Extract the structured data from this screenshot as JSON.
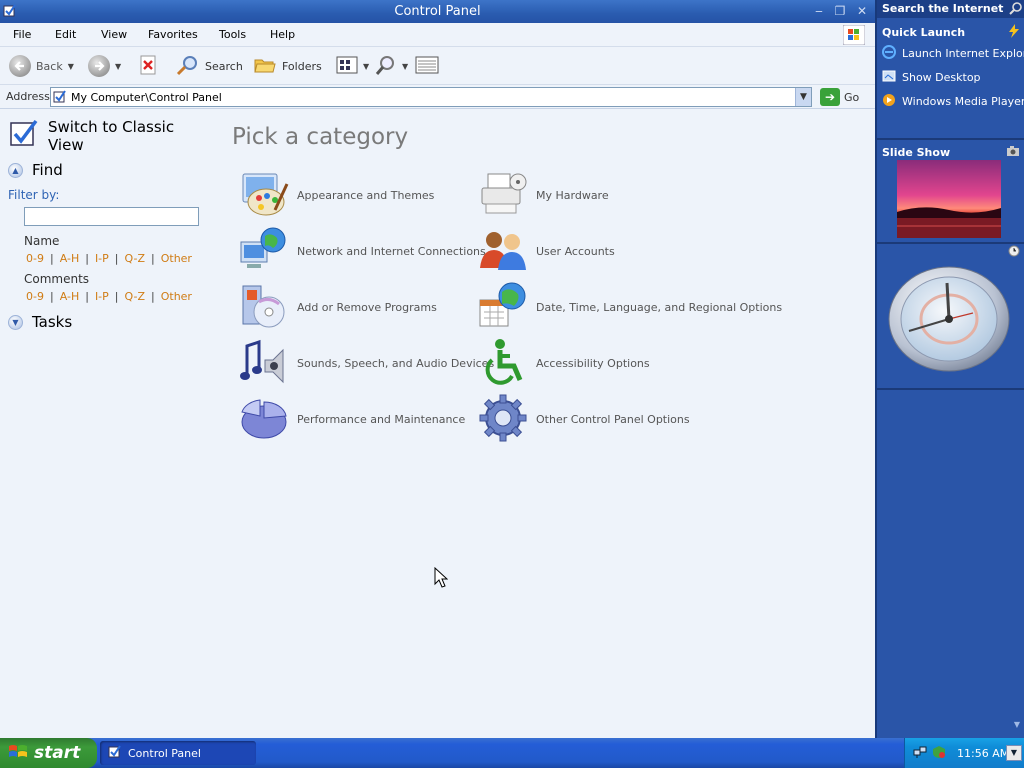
{
  "window": {
    "title": "Control Panel",
    "controls": {
      "minimize": "‒",
      "restore": "❐",
      "close": "✕"
    }
  },
  "menu": [
    "File",
    "Edit",
    "View",
    "Favorites",
    "Tools",
    "Help"
  ],
  "toolbar": {
    "back_label": "Back",
    "search_label": "Search",
    "folders_label": "Folders"
  },
  "address": {
    "label": "Address",
    "value": "My Computer\\Control Panel",
    "go_label": "Go"
  },
  "leftpane": {
    "switch_label": "Switch to Classic View",
    "find_label": "Find",
    "filter_label": "Filter by:",
    "filter_value": "",
    "name_label": "Name",
    "comments_label": "Comments",
    "filter_links": [
      "0-9",
      "A-H",
      "I-P",
      "Q-Z",
      "Other"
    ],
    "separator": "|",
    "tasks_label": "Tasks"
  },
  "main": {
    "title": "Pick a category",
    "categories": [
      {
        "label": "Appearance and Themes",
        "icon": "appearance-icon"
      },
      {
        "label": "My Hardware",
        "icon": "printer-icon"
      },
      {
        "label": "Network and Internet Connections",
        "icon": "network-icon"
      },
      {
        "label": "User Accounts",
        "icon": "users-icon"
      },
      {
        "label": "Add or Remove Programs",
        "icon": "cd-install-icon"
      },
      {
        "label": "Date, Time, Language, and Regional Options",
        "icon": "calendar-globe-icon"
      },
      {
        "label": "Sounds, Speech, and Audio Devices",
        "icon": "speaker-music-icon"
      },
      {
        "label": "Accessibility Options",
        "icon": "wheelchair-icon"
      },
      {
        "label": "Performance and Maintenance",
        "icon": "pie-chart-icon"
      },
      {
        "label": "Other Control Panel Options",
        "icon": "gear-icon"
      }
    ]
  },
  "sidebar": {
    "search_label": "Search the Internet",
    "quick_launch_label": "Quick Launch",
    "quick_launch_items": [
      "Launch Internet Explorer",
      "Show Desktop",
      "Windows Media Player"
    ],
    "slideshow_label": "Slide Show"
  },
  "taskbar": {
    "start_label": "start",
    "task_label": "Control Panel",
    "clock": "11:56 AM"
  },
  "colors": {
    "titlebar": "#2a5cb0",
    "link_orange": "#d07c14",
    "filter_blue": "#2f64b4",
    "sidebar_bg": "#2a55a8",
    "start_green": "#3c9a3a"
  }
}
